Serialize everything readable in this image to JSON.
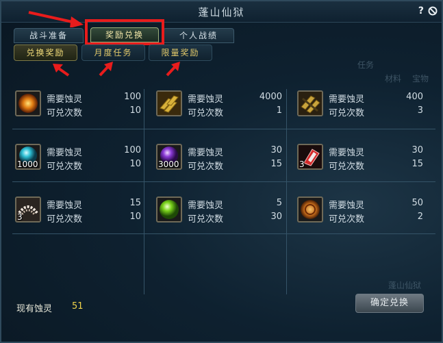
{
  "window": {
    "title": "蓬山仙狱",
    "help_label": "?"
  },
  "tabs": [
    {
      "label": "战斗准备"
    },
    {
      "label": "奖励兑换"
    },
    {
      "label": "个人战绩"
    }
  ],
  "subtabs": [
    {
      "label": "兑换奖励"
    },
    {
      "label": "月度任务"
    },
    {
      "label": "限量奖励"
    }
  ],
  "rewards": [
    {
      "icon": "fire-orb-icon",
      "cost_label": "需要蚀灵",
      "cost": "100",
      "count_label": "可兑次数",
      "count": "10",
      "qty": ""
    },
    {
      "icon": "gold-bars-icon",
      "cost_label": "需要蚀灵",
      "cost": "4000",
      "count_label": "可兑次数",
      "count": "1",
      "qty": ""
    },
    {
      "icon": "gold-scroll-icon",
      "cost_label": "需要蚀灵",
      "cost": "400",
      "count_label": "可兑次数",
      "count": "3",
      "qty": ""
    },
    {
      "icon": "cyan-orb-icon",
      "cost_label": "需要蚀灵",
      "cost": "100",
      "count_label": "可兑次数",
      "count": "10",
      "qty": "1000"
    },
    {
      "icon": "purple-orb-icon",
      "cost_label": "需要蚀灵",
      "cost": "30",
      "count_label": "可兑次数",
      "count": "15",
      "qty": "3000"
    },
    {
      "icon": "red-crystal-icon",
      "cost_label": "需要蚀灵",
      "cost": "30",
      "count_label": "可兑次数",
      "count": "15",
      "qty": "3"
    },
    {
      "icon": "pearl-necklace-icon",
      "cost_label": "需要蚀灵",
      "cost": "15",
      "count_label": "可兑次数",
      "count": "10",
      "qty": "3"
    },
    {
      "icon": "green-orb-icon",
      "cost_label": "需要蚀灵",
      "cost": "5",
      "count_label": "可兑次数",
      "count": "30",
      "qty": ""
    },
    {
      "icon": "bronze-coin-icon",
      "cost_label": "需要蚀灵",
      "cost": "50",
      "count_label": "可兑次数",
      "count": "2",
      "qty": ""
    }
  ],
  "footer": {
    "currency_label": "现有蚀灵",
    "currency_value": "51",
    "confirm_label": "确定兑换"
  },
  "background": {
    "text1": "任务",
    "text2": "材料",
    "text3": "宝物",
    "text4": "蓬山仙狱"
  },
  "colors": {
    "highlight": "#e81c1c",
    "accent_gold": "#f1d44a",
    "panel_bg": "#0e2130"
  }
}
